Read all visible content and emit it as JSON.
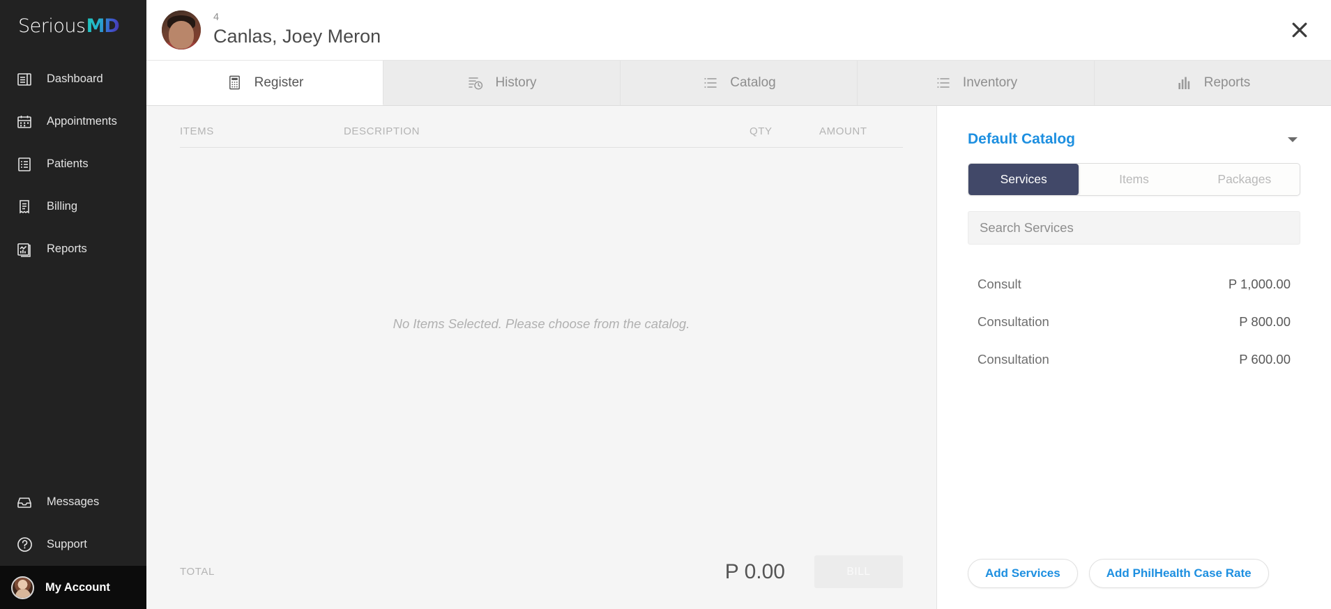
{
  "brand": {
    "name_part1": "Serious",
    "name_part2": "MD",
    "accent_teal": "#1fc8b8",
    "accent_blue": "#3d5bd0",
    "accent_purple": "#4b2fa8"
  },
  "sidebar": {
    "items": [
      {
        "label": "Dashboard",
        "icon": "dashboard-icon"
      },
      {
        "label": "Appointments",
        "icon": "calendar-icon"
      },
      {
        "label": "Patients",
        "icon": "list-document-icon"
      },
      {
        "label": "Billing",
        "icon": "receipt-icon"
      },
      {
        "label": "Reports",
        "icon": "chart-document-icon"
      }
    ],
    "bottom_items": [
      {
        "label": "Messages",
        "icon": "inbox-icon"
      },
      {
        "label": "Support",
        "icon": "question-circle-icon"
      }
    ],
    "account": {
      "label": "My Account",
      "icon": "avatar"
    }
  },
  "patient": {
    "id": "4",
    "name": "Canlas, Joey Meron",
    "avatar": "patient-photo"
  },
  "close_label": "✕",
  "tabs": [
    {
      "label": "Register",
      "icon": "calculator-icon",
      "active": true
    },
    {
      "label": "History",
      "icon": "history-clock-icon",
      "active": false
    },
    {
      "label": "Catalog",
      "icon": "list-icon",
      "active": false
    },
    {
      "label": "Inventory",
      "icon": "list-icon",
      "active": false
    },
    {
      "label": "Reports",
      "icon": "bar-chart-icon",
      "active": false
    }
  ],
  "register": {
    "columns": {
      "items": "ITEMS",
      "description": "DESCRIPTION",
      "qty": "QTY",
      "amount": "AMOUNT"
    },
    "empty_message": "No Items Selected. Please choose from the catalog.",
    "total_label": "TOTAL",
    "total_amount": "P 0.00",
    "bill_button": "BILL",
    "bill_button_disabled": true
  },
  "catalog": {
    "selected_catalog": "Default Catalog",
    "catalog_color": "#1d8fe0",
    "segments": [
      {
        "label": "Services",
        "active": true
      },
      {
        "label": "Items",
        "active": false
      },
      {
        "label": "Packages",
        "active": false
      }
    ],
    "search": {
      "value": "",
      "placeholder": "Search Services"
    },
    "services": [
      {
        "name": "Consult",
        "price": "P 1,000.00"
      },
      {
        "name": "Consultation",
        "price": "P 800.00"
      },
      {
        "name": "Consultation",
        "price": "P 600.00"
      }
    ],
    "actions": [
      {
        "label": "Add Services"
      },
      {
        "label": "Add PhilHealth Case Rate"
      }
    ]
  }
}
